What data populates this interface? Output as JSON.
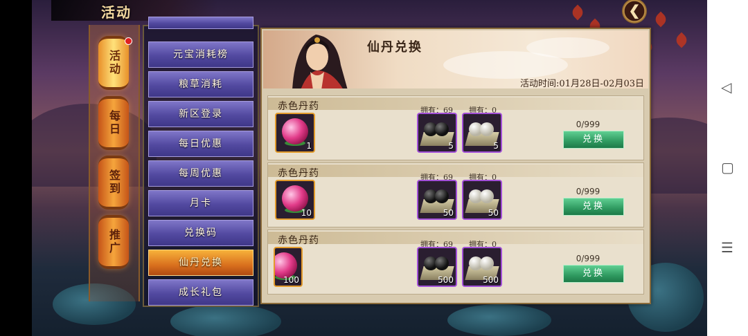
{
  "header": {
    "title": "活动",
    "back_icon": "back-arrow-icon"
  },
  "lanterns": [
    {
      "label": "活动",
      "active": true,
      "has_badge": true
    },
    {
      "label": "每日",
      "active": false
    },
    {
      "label": "签到",
      "active": false
    },
    {
      "label": "推广",
      "active": false
    }
  ],
  "menu": [
    {
      "label": "元宝消耗榜",
      "active": false
    },
    {
      "label": "粮草消耗",
      "active": false
    },
    {
      "label": "新区登录",
      "active": false
    },
    {
      "label": "每日优惠",
      "active": false
    },
    {
      "label": "每周优惠",
      "active": false
    },
    {
      "label": "月卡",
      "active": false
    },
    {
      "label": "兑换码",
      "active": false
    },
    {
      "label": "仙丹兑换",
      "active": true
    },
    {
      "label": "成长礼包",
      "active": false
    }
  ],
  "banner": {
    "title": "仙丹兑换",
    "time": "活动时间:01月28日-02月03日"
  },
  "rows": [
    {
      "title": "赤色丹药",
      "reward_qty": "1",
      "owned_black": "拥有：69",
      "owned_white": "拥有：0",
      "cost_black": "5",
      "cost_white": "5",
      "count": "0/999",
      "button": "兑换"
    },
    {
      "title": "赤色丹药",
      "reward_qty": "10",
      "owned_black": "拥有：69",
      "owned_white": "拥有：0",
      "cost_black": "50",
      "cost_white": "50",
      "count": "0/999",
      "button": "兑换"
    },
    {
      "title": "赤色丹药",
      "reward_qty": "100",
      "owned_black": "拥有：69",
      "owned_white": "拥有：0",
      "cost_black": "500",
      "cost_white": "500",
      "count": "0/999",
      "button": "兑换"
    }
  ],
  "system_nav": {
    "back": "◁",
    "home": "▢",
    "menu": "☰"
  },
  "colors": {
    "accent_orange": "#f5a53c",
    "menu_purple": "#5249a0",
    "button_green": "#2f9a60",
    "rare_purple": "#a24fd8"
  }
}
